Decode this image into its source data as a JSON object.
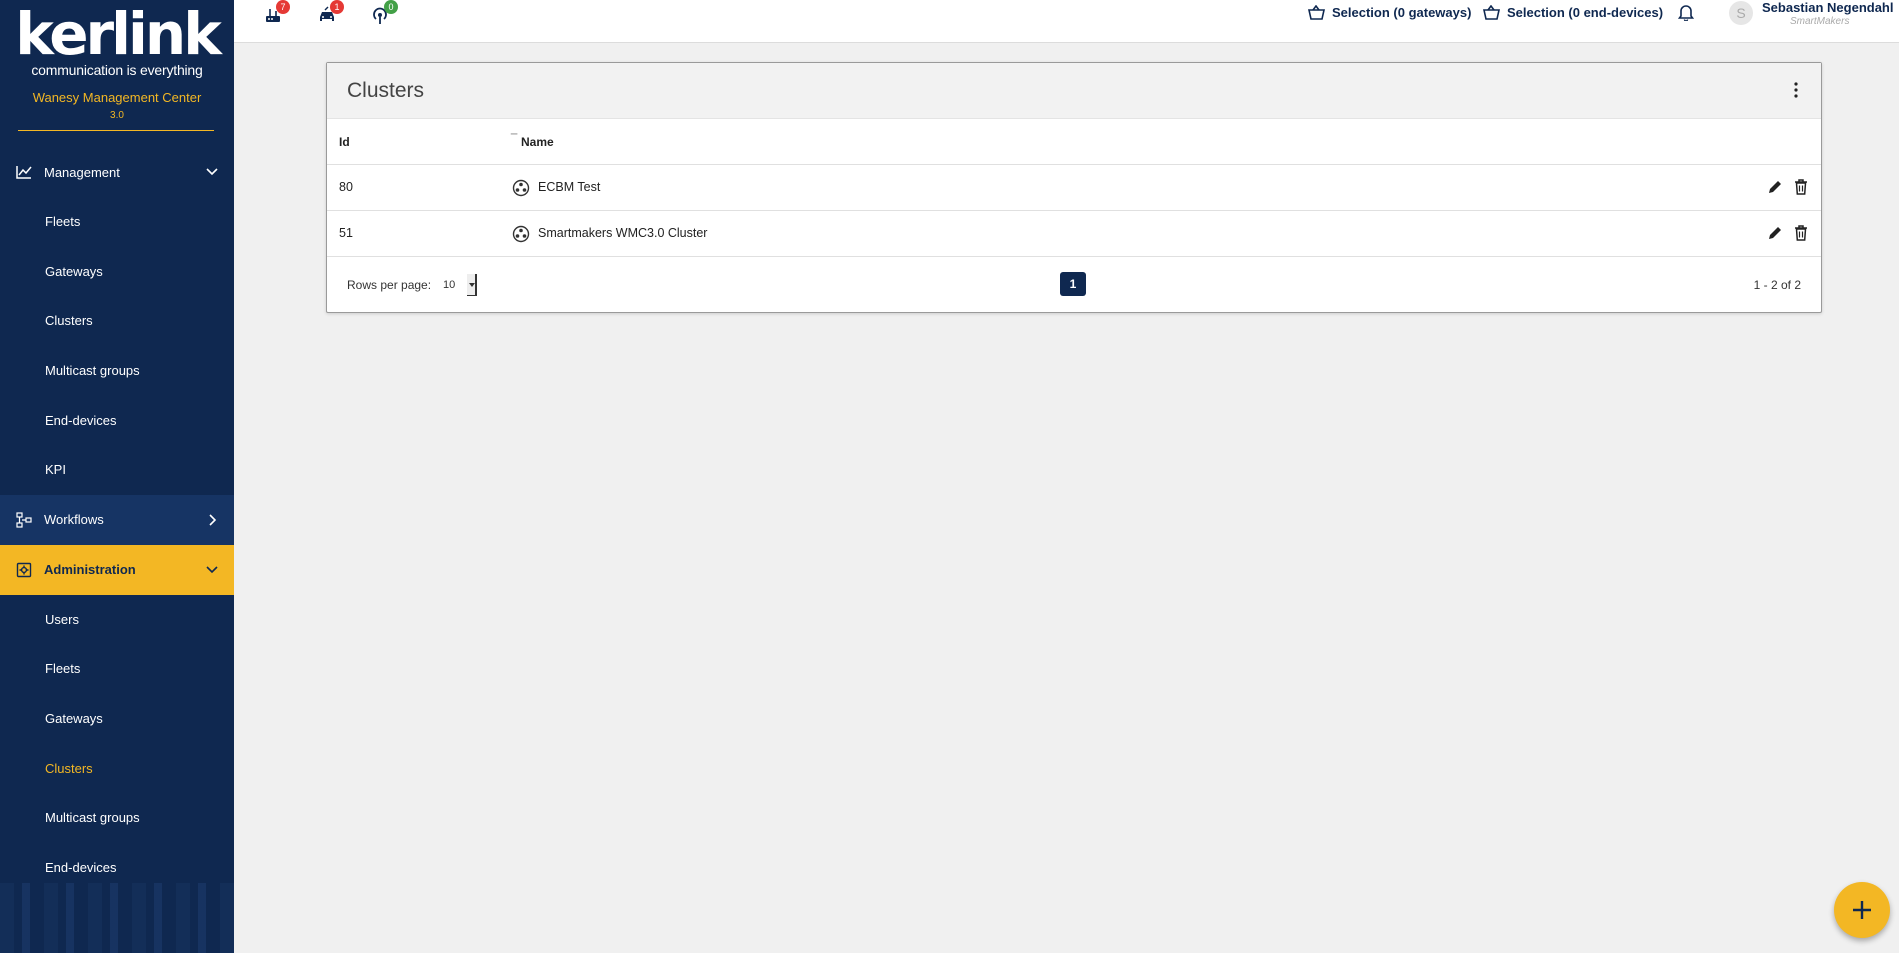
{
  "brand": {
    "logo_text": "kerlink",
    "tagline": "communication is everything",
    "app_name": "Wanesy Management Center",
    "version": "3.0"
  },
  "sidebar": {
    "management": {
      "label": "Management",
      "items": [
        "Fleets",
        "Gateways",
        "Clusters",
        "Multicast groups",
        "End-devices",
        "KPI"
      ]
    },
    "workflows": {
      "label": "Workflows"
    },
    "administration": {
      "label": "Administration",
      "items": [
        "Users",
        "Fleets",
        "Gateways",
        "Clusters",
        "Multicast groups",
        "End-devices"
      ],
      "active": "Clusters"
    }
  },
  "topbar": {
    "gateways_badge": "7",
    "vehicles_badge": "1",
    "signal_badge": "0",
    "badge_colors": {
      "gateways": "#e53935",
      "vehicles": "#e53935",
      "signal": "#43a047"
    },
    "selection_gateways": "Selection (0 gateways)",
    "selection_enddevices": "Selection (0 end-devices)",
    "user_initial": "S",
    "user_name": "Sebastian Negendahl",
    "user_org": "SmartMakers"
  },
  "card": {
    "title": "Clusters",
    "columns": {
      "id": "Id",
      "name": "Name"
    },
    "rows": [
      {
        "id": "80",
        "name": "ECBM Test"
      },
      {
        "id": "51",
        "name": "Smartmakers WMC3.0 Cluster"
      }
    ],
    "rows_per_page_label": "Rows per page:",
    "rows_per_page": "10",
    "current_page": "1",
    "range_text": "1 - 2 of 2"
  },
  "colors": {
    "sidebar": "#0f2850",
    "accent": "#f3b724"
  }
}
